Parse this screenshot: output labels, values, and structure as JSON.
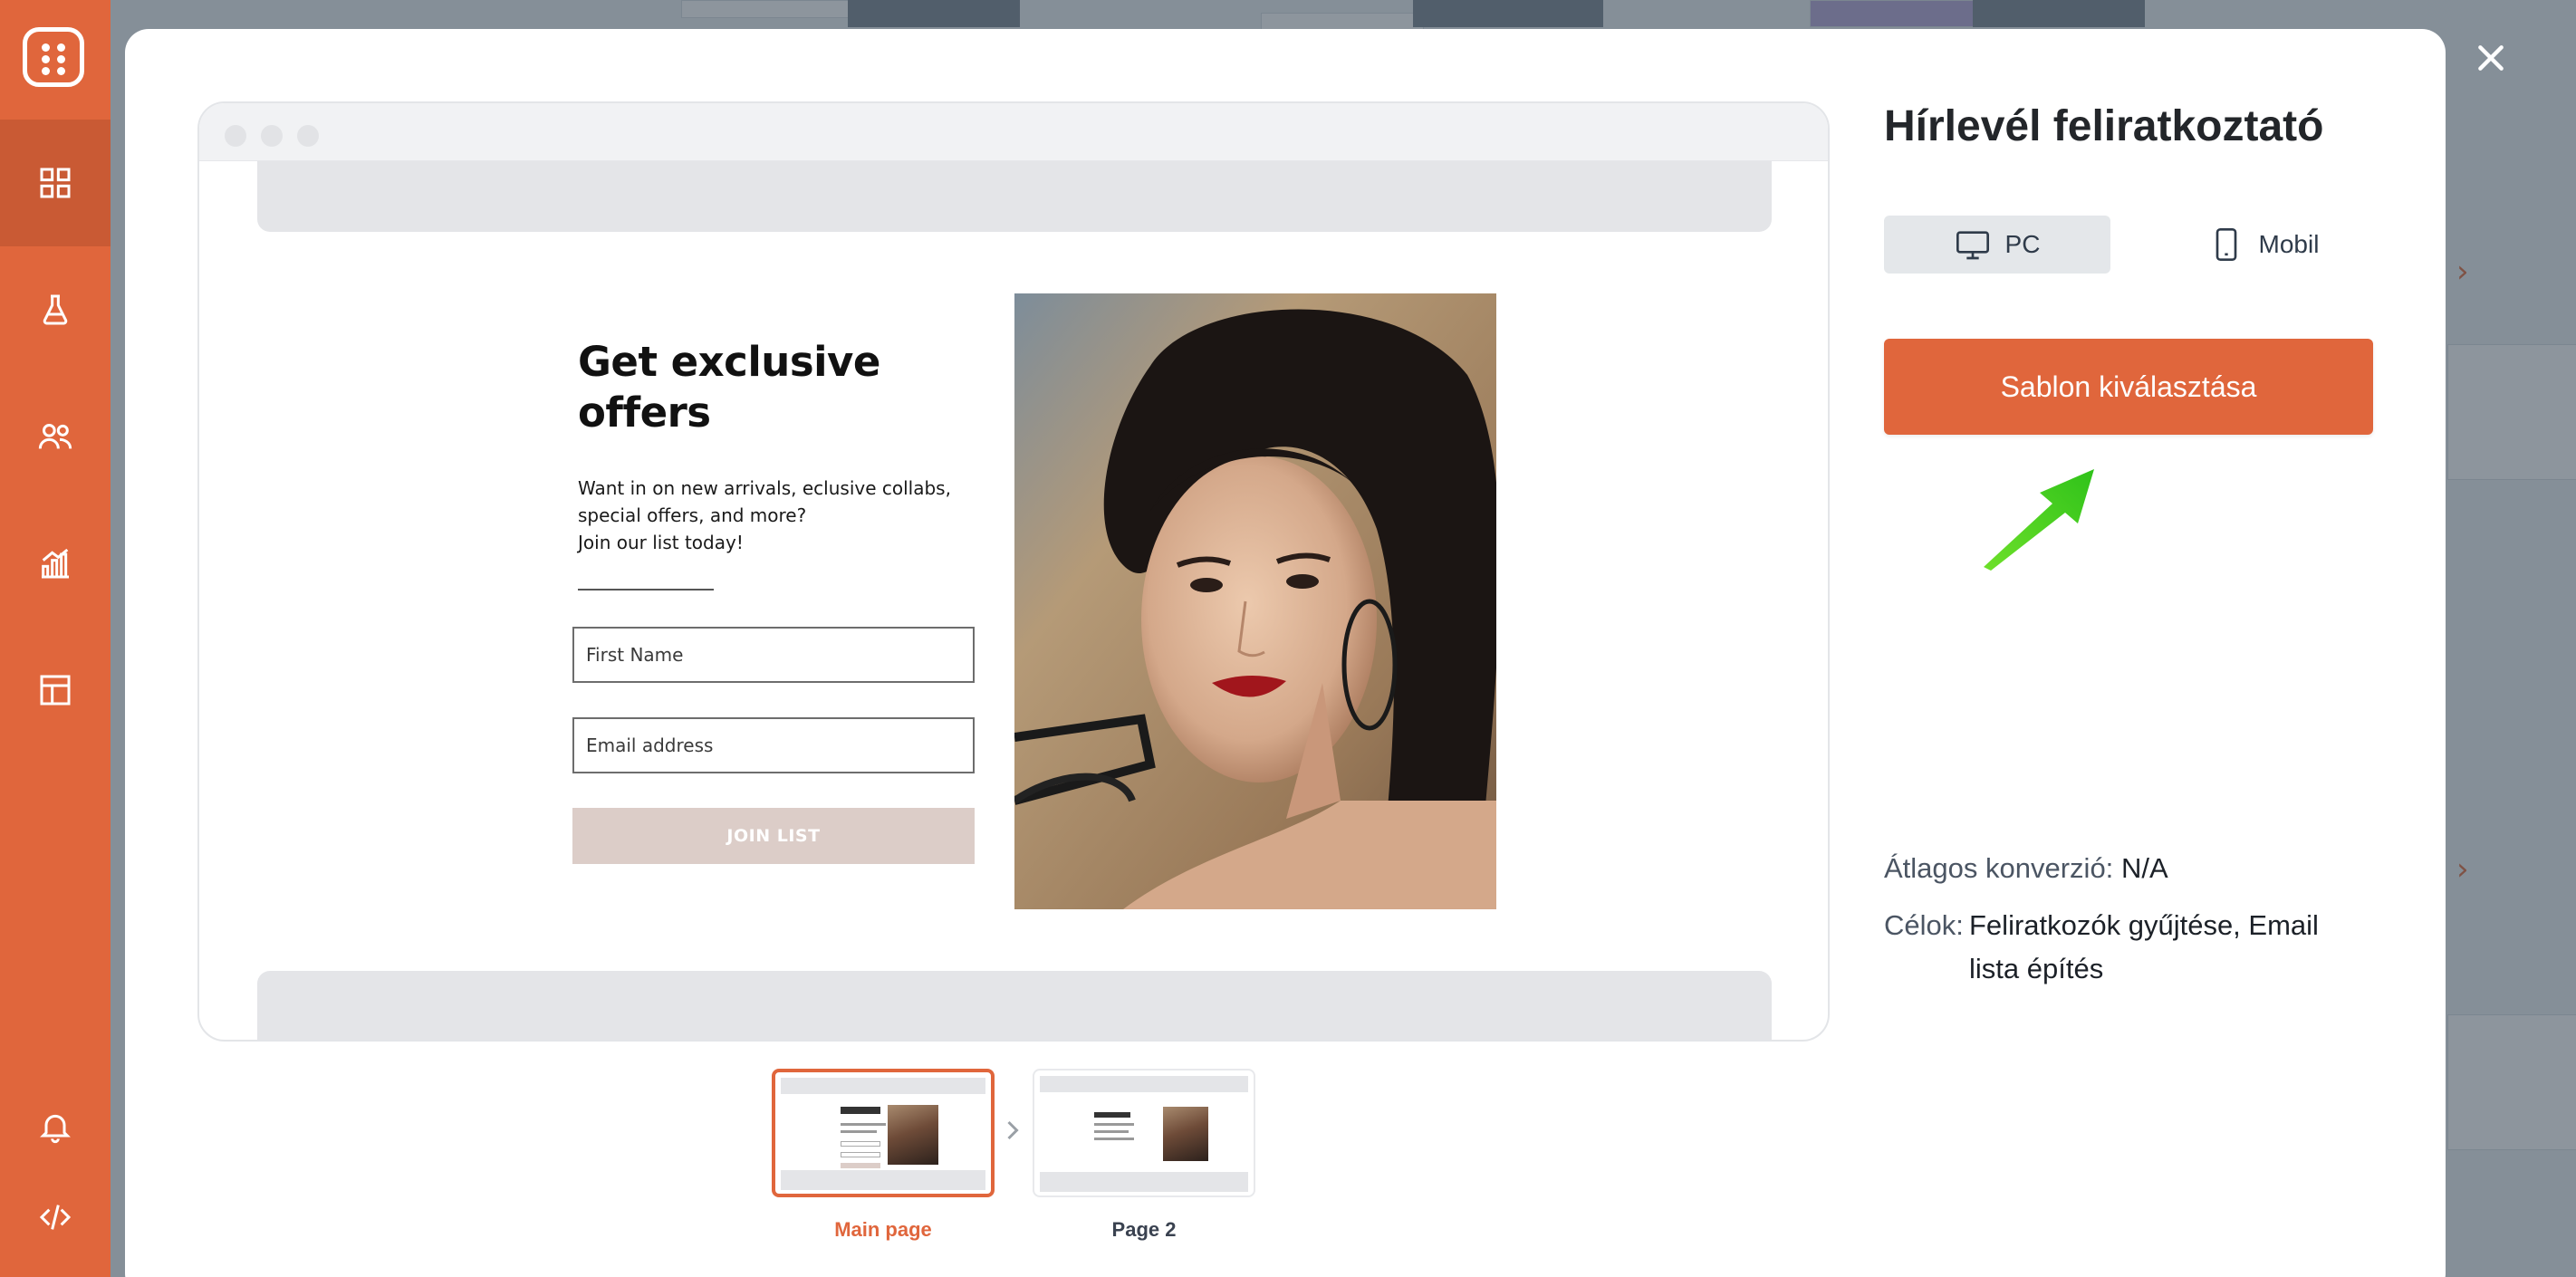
{
  "template": {
    "title": "Hírlevél feliratkoztató",
    "select_label": "Sablon kiválasztása",
    "stats": {
      "conversion_label": "Átlagos konverzió:",
      "conversion_value": "N/A",
      "goals_label": "Célok:",
      "goals_value": "Feliratkozók gyűjtése, Email lista építés"
    }
  },
  "devices": [
    {
      "label": "PC",
      "icon": "monitor-icon",
      "active": true
    },
    {
      "label": "Mobil",
      "icon": "mobile-icon",
      "active": false
    }
  ],
  "preview": {
    "heading": "Get exclusive offers",
    "description": "Want in on new arrivals, eclusive collabs,\nspecial offers, and more?\nJoin our list today!",
    "first_name_placeholder": "First Name",
    "email_placeholder": "Email address",
    "button_label": "JOIN LIST"
  },
  "pages": [
    {
      "label": "Main page",
      "active": true
    },
    {
      "label": "Page 2",
      "active": false
    }
  ],
  "sidebar": {
    "items": [
      {
        "icon": "dashboard-grid-icon",
        "active": true
      },
      {
        "icon": "flask-icon",
        "active": false
      },
      {
        "icon": "users-icon",
        "active": false
      },
      {
        "icon": "analytics-chart-icon",
        "active": false
      },
      {
        "icon": "layout-icon",
        "active": false
      },
      {
        "icon": "bell-icon",
        "active": false
      },
      {
        "icon": "code-icon",
        "active": false
      }
    ]
  },
  "colors": {
    "accent": "#e0663c",
    "sidebar": "#e0663c",
    "sidebar_active": "#c95a34",
    "button_disabled": "#dccdc8",
    "arrow": "#4ccc1a"
  }
}
